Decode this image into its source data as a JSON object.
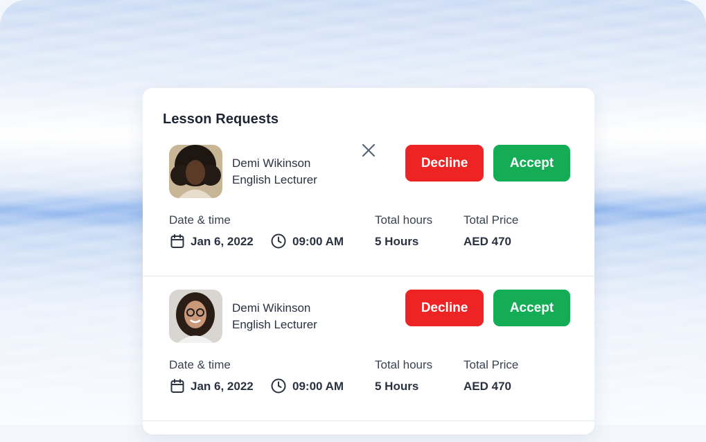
{
  "card": {
    "title": "Lesson Requests"
  },
  "requests": [
    {
      "name": "Demi Wikinson",
      "role": "English Lecturer",
      "decline_label": "Decline",
      "accept_label": "Accept",
      "date_time_label": "Date & time",
      "date": "Jan 6, 2022",
      "time": "09:00 AM",
      "total_hours_label": "Total hours",
      "total_hours": "5 Hours",
      "total_price_label": "Total Price",
      "total_price": "AED 470"
    },
    {
      "name": "Demi Wikinson",
      "role": "English Lecturer",
      "decline_label": "Decline",
      "accept_label": "Accept",
      "date_time_label": "Date & time",
      "date": "Jan 6, 2022",
      "time": "09:00 AM",
      "total_hours_label": "Total hours",
      "total_hours": "5 Hours",
      "total_price_label": "Total Price",
      "total_price": "AED 470"
    }
  ],
  "colors": {
    "decline": "#ee2424",
    "accept": "#14ad55",
    "text": "#1c2433"
  },
  "icons": [
    "close-icon",
    "calendar-icon",
    "clock-icon"
  ]
}
